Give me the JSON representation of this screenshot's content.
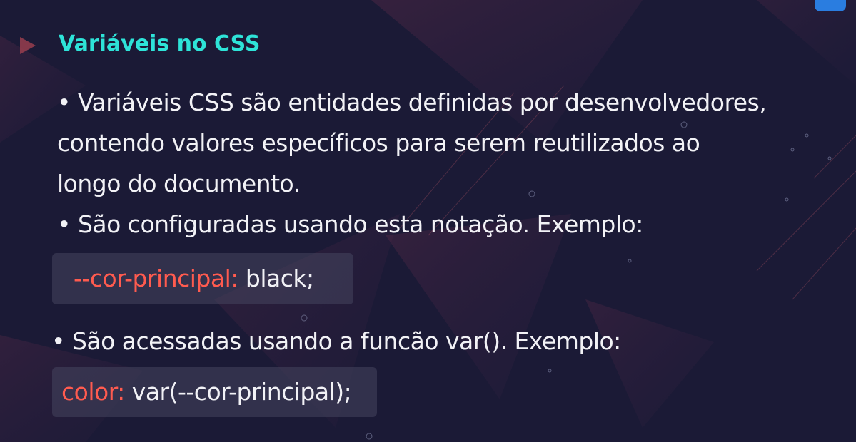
{
  "slide": {
    "title": "Variáveis no CSS",
    "bullets": [
      {
        "lines": [
          "• Variáveis CSS são entidades definidas por desenvolvedores,",
          "contendo valores específicos para serem reutilizados ao",
          "longo do documento."
        ]
      },
      {
        "lines": [
          "• São configuradas usando esta notação. Exemplo:"
        ]
      },
      {
        "lines": [
          "• São acessadas usando a funcão var(). Exemplo:"
        ]
      }
    ],
    "code1": {
      "property": "--cor-principal:",
      "value": " black;"
    },
    "code2": {
      "property": "color:",
      "value": " var(--cor-principal);"
    }
  },
  "colors": {
    "title": "#2ee3d8",
    "code_property": "#ff5b4f",
    "background": "#1b1a36"
  },
  "logo_icon": "cube-logo-icon"
}
